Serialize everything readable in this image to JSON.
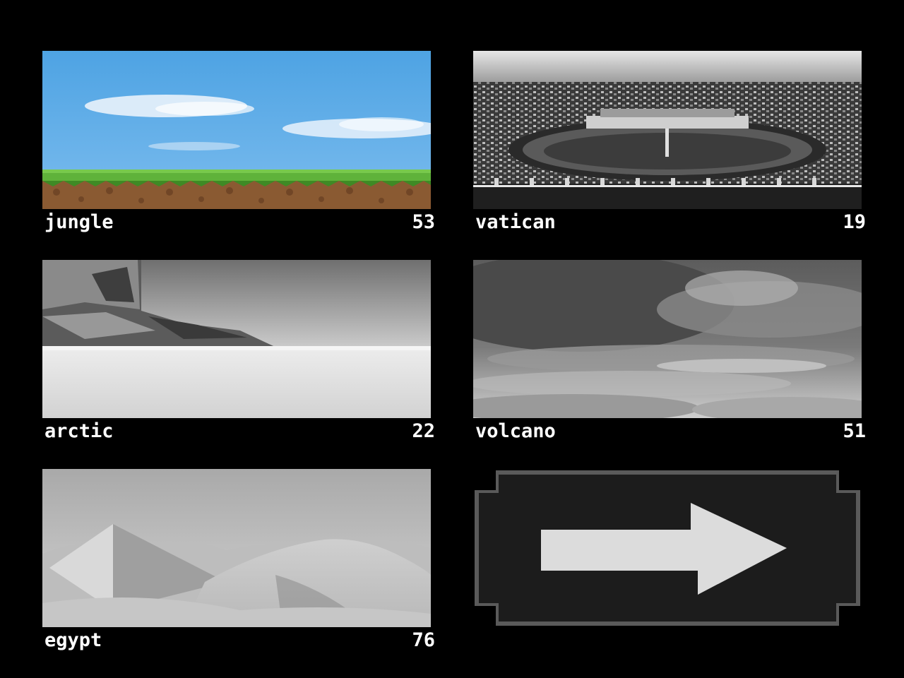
{
  "levels": [
    {
      "name": "jungle",
      "count": "53"
    },
    {
      "name": "vatican",
      "count": "19"
    },
    {
      "name": "arctic",
      "count": "22"
    },
    {
      "name": "volcano",
      "count": "51"
    },
    {
      "name": "egypt",
      "count": "76"
    }
  ],
  "next": {
    "icon": "arrow-right-icon"
  },
  "colors": {
    "background": "#000000",
    "text": "#ffffff",
    "sky": "#5aa9e6",
    "grass": "#5fb23a",
    "dirt": "#8a5a32",
    "next_panel": "#1c1c1c",
    "next_border": "#5a5a5a",
    "arrow": "#dcdcdc"
  }
}
